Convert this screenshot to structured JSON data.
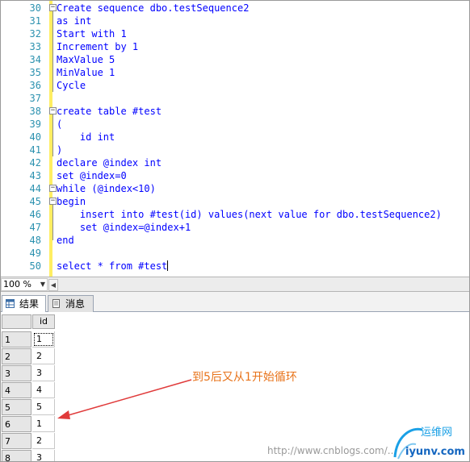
{
  "editor": {
    "lines": [
      {
        "num": "30",
        "text": "Create sequence dbo.testSequence2"
      },
      {
        "num": "31",
        "text": "as int"
      },
      {
        "num": "32",
        "text": "Start with 1"
      },
      {
        "num": "33",
        "text": "Increment by 1"
      },
      {
        "num": "34",
        "text": "MaxValue 5"
      },
      {
        "num": "35",
        "text": "MinValue 1"
      },
      {
        "num": "36",
        "text": "Cycle"
      },
      {
        "num": "37",
        "text": ""
      },
      {
        "num": "38",
        "text": "create table #test"
      },
      {
        "num": "39",
        "text": "("
      },
      {
        "num": "40",
        "text": "    id int"
      },
      {
        "num": "41",
        "text": ")"
      },
      {
        "num": "42",
        "text": "declare @index int"
      },
      {
        "num": "43",
        "text": "set @index=0"
      },
      {
        "num": "44",
        "text": "while (@index<10)"
      },
      {
        "num": "45",
        "text": "begin"
      },
      {
        "num": "46",
        "text": "    insert into #test(id) values(next value for dbo.testSequence2)"
      },
      {
        "num": "47",
        "text": "    set @index=@index+1"
      },
      {
        "num": "48",
        "text": "end"
      },
      {
        "num": "49",
        "text": ""
      },
      {
        "num": "50",
        "text": "select * from #test"
      }
    ]
  },
  "status": {
    "zoom": "100 %"
  },
  "tabs": {
    "results": "结果",
    "messages": "消息"
  },
  "grid": {
    "column": "id",
    "rows": [
      {
        "n": "1",
        "id": "1"
      },
      {
        "n": "2",
        "id": "2"
      },
      {
        "n": "3",
        "id": "3"
      },
      {
        "n": "4",
        "id": "4"
      },
      {
        "n": "5",
        "id": "5"
      },
      {
        "n": "6",
        "id": "1"
      },
      {
        "n": "7",
        "id": "2"
      },
      {
        "n": "8",
        "id": "3"
      }
    ]
  },
  "annotation": "到5后又从1开始循环",
  "watermark": {
    "url": "http://www.cnblogs.com/...",
    "logo_top": "运维网",
    "logo_bottom": "iyunv.com"
  },
  "colors": {
    "keyword": "#0000ff",
    "line_number": "#2b91af",
    "annotation": "#e8731a",
    "arrow": "#e03a3a"
  }
}
